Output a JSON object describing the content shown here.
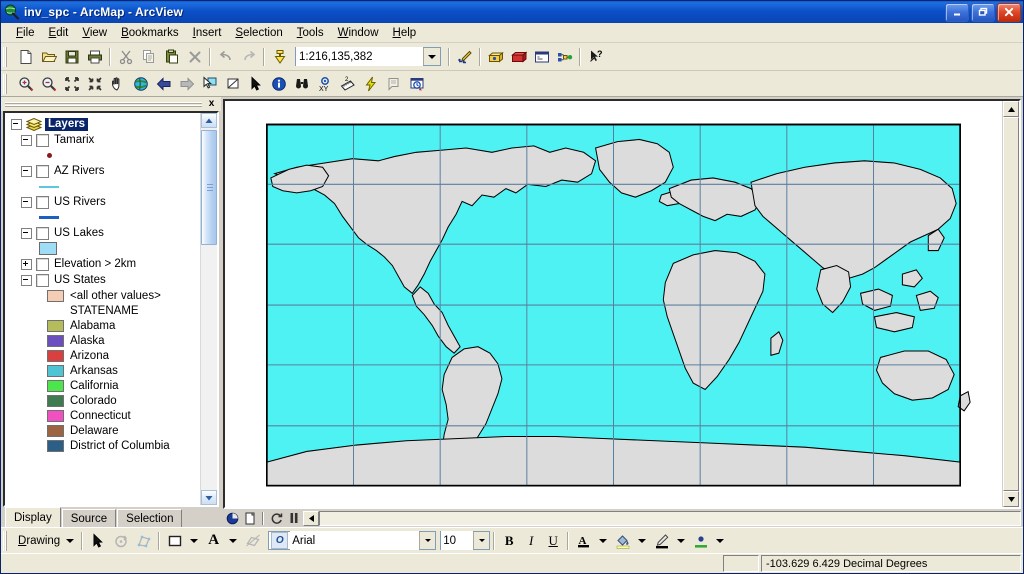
{
  "window": {
    "title": "inv_spc - ArcMap - ArcView",
    "app_icon": "arcmap-globe-icon",
    "minimize_label": "Minimize",
    "restore_label": "Restore",
    "close_label": "Close"
  },
  "menu": {
    "items": [
      {
        "label": "File",
        "accel": "F"
      },
      {
        "label": "Edit",
        "accel": "E"
      },
      {
        "label": "View",
        "accel": "V"
      },
      {
        "label": "Bookmarks",
        "accel": "B"
      },
      {
        "label": "Insert",
        "accel": "I"
      },
      {
        "label": "Selection",
        "accel": "S"
      },
      {
        "label": "Tools",
        "accel": "T"
      },
      {
        "label": "Window",
        "accel": "W"
      },
      {
        "label": "Help",
        "accel": "H"
      }
    ]
  },
  "standard_toolbar": {
    "buttons": [
      {
        "name": "new-document-icon",
        "tip": "New"
      },
      {
        "name": "open-folder-icon",
        "tip": "Open"
      },
      {
        "name": "save-disk-icon",
        "tip": "Save"
      },
      {
        "name": "print-icon",
        "tip": "Print"
      },
      {
        "name": "cut-scissors-icon",
        "tip": "Cut"
      },
      {
        "name": "copy-icon",
        "tip": "Copy"
      },
      {
        "name": "paste-clipboard-icon",
        "tip": "Paste"
      },
      {
        "name": "delete-x-icon",
        "tip": "Delete"
      },
      {
        "name": "undo-arrow-icon",
        "tip": "Undo"
      },
      {
        "name": "redo-arrow-icon",
        "tip": "Redo"
      },
      {
        "name": "add-data-icon",
        "tip": "Add Data"
      }
    ],
    "scale": {
      "value": "1:216,135,382",
      "placeholder": "Map Scale"
    },
    "right_buttons": [
      {
        "name": "editor-toolbar-icon",
        "tip": "Editor Toolbar"
      },
      {
        "name": "arctoolbox-icon",
        "tip": "ArcToolbox"
      },
      {
        "name": "arccatalog-icon",
        "tip": "ArcCatalog"
      },
      {
        "name": "command-line-icon",
        "tip": "Command Line"
      },
      {
        "name": "model-builder-icon",
        "tip": "ModelBuilder"
      },
      {
        "name": "context-help-icon",
        "tip": "What's This?"
      }
    ]
  },
  "tools_toolbar": {
    "buttons": [
      {
        "name": "zoom-in-icon",
        "tip": "Zoom In"
      },
      {
        "name": "zoom-out-icon",
        "tip": "Zoom Out"
      },
      {
        "name": "fixed-zoom-in-icon",
        "tip": "Fixed Zoom In"
      },
      {
        "name": "fixed-zoom-out-icon",
        "tip": "Fixed Zoom Out"
      },
      {
        "name": "pan-hand-icon",
        "tip": "Pan"
      },
      {
        "name": "full-extent-globe-icon",
        "tip": "Full Extent"
      },
      {
        "name": "back-extent-icon",
        "tip": "Go Back To Previous Extent"
      },
      {
        "name": "forward-extent-icon",
        "tip": "Go To Next Extent"
      },
      {
        "name": "select-features-icon",
        "tip": "Select Features"
      },
      {
        "name": "clear-selection-icon",
        "tip": "Clear Selected Features"
      },
      {
        "name": "select-elements-icon",
        "tip": "Select Elements"
      },
      {
        "name": "identify-icon",
        "tip": "Identify"
      },
      {
        "name": "find-binoculars-icon",
        "tip": "Find"
      },
      {
        "name": "go-to-xy-icon",
        "tip": "Go To XY"
      },
      {
        "name": "measure-ruler-icon",
        "tip": "Measure"
      },
      {
        "name": "hyperlink-lightning-icon",
        "tip": "Hyperlink"
      },
      {
        "name": "html-popup-icon",
        "tip": "HTML Popup"
      },
      {
        "name": "time-window-icon",
        "tip": "Time Slider"
      }
    ]
  },
  "toc": {
    "close_label": "x",
    "root": {
      "label": "Layers",
      "selected": true,
      "icon": "layers-stack-icon"
    },
    "layers": [
      {
        "label": "Tamarix",
        "checked": false,
        "expander": "minus",
        "symbol": {
          "kind": "point",
          "color": "#8B1A1A"
        }
      },
      {
        "label": "AZ Rivers",
        "checked": false,
        "expander": "minus",
        "symbol": {
          "kind": "thin-line",
          "color": "#5BC8DC"
        }
      },
      {
        "label": "US Rivers",
        "checked": false,
        "expander": "minus",
        "symbol": {
          "kind": "line",
          "color": "#1F5FBF"
        }
      },
      {
        "label": "US Lakes",
        "checked": false,
        "expander": "minus",
        "symbol": {
          "kind": "polygon",
          "color": "#9FDCF5"
        }
      },
      {
        "label": "Elevation > 2km",
        "checked": false,
        "expander": "plus",
        "symbol": null
      },
      {
        "label": "US States",
        "checked": false,
        "expander": "minus",
        "symbol": null
      }
    ],
    "us_states_legend": {
      "other_values": {
        "label": "<all other values>",
        "color": "#F5CDB4"
      },
      "field_heading": "STATENAME",
      "classes": [
        {
          "label": "Alabama",
          "color": "#B5BC5C"
        },
        {
          "label": "Alaska",
          "color": "#6B4FBF"
        },
        {
          "label": "Arizona",
          "color": "#D94040"
        },
        {
          "label": "Arkansas",
          "color": "#4FC4D4"
        },
        {
          "label": "California",
          "color": "#4CE64C"
        },
        {
          "label": "Colorado",
          "color": "#3F7A50"
        },
        {
          "label": "Connecticut",
          "color": "#F050C0"
        },
        {
          "label": "Delaware",
          "color": "#9C6442"
        },
        {
          "label": "District of Columbia",
          "color": "#2B5F85"
        }
      ]
    },
    "tabs": [
      {
        "label": "Display",
        "active": true
      },
      {
        "label": "Source",
        "active": false
      },
      {
        "label": "Selection",
        "active": false
      }
    ]
  },
  "map_view": {
    "ocean_color": "#4FF2F2",
    "land_color": "#DCDCDC",
    "outline_color": "#000000",
    "graticule_color": "#5B7F9E",
    "background_color": "#FFFFFF",
    "view_buttons": [
      {
        "name": "data-view-icon",
        "tip": "Data View"
      },
      {
        "name": "layout-view-icon",
        "tip": "Layout View"
      },
      {
        "name": "refresh-view-icon",
        "tip": "Refresh View"
      },
      {
        "name": "pause-drawing-icon",
        "tip": "Pause Drawing"
      }
    ]
  },
  "drawing_toolbar": {
    "menu_label": "Drawing",
    "buttons": [
      {
        "name": "select-elements-arrow-icon",
        "tip": "Select Elements"
      },
      {
        "name": "rotate-element-icon",
        "tip": "Rotate"
      },
      {
        "name": "edit-vertices-icon",
        "tip": "Edit Vertices"
      },
      {
        "name": "new-rectangle-icon",
        "tip": "Draw Rectangle"
      },
      {
        "name": "new-text-icon",
        "tip": "New Text"
      },
      {
        "name": "drawing-clip-icon",
        "tip": "Clip Graphic"
      }
    ],
    "font": {
      "name_value": "Arial",
      "name_placeholder": "Font",
      "size_value": "10",
      "size_placeholder": "Size",
      "icon": "font-o-icon"
    },
    "style_buttons": [
      {
        "name": "bold-button",
        "label": "B"
      },
      {
        "name": "italic-button",
        "label": "I"
      },
      {
        "name": "underline-button",
        "label": "U"
      }
    ],
    "color_buttons": [
      {
        "name": "font-color-icon",
        "label": "A",
        "color": "#000000"
      },
      {
        "name": "fill-color-icon",
        "label": "fill",
        "color": "#FFFF99"
      },
      {
        "name": "line-color-icon",
        "label": "line",
        "color": "#000000"
      },
      {
        "name": "marker-color-icon",
        "label": "marker",
        "color": "#33AA33"
      }
    ]
  },
  "status_bar": {
    "coordinates": "-103.629  6.429 Decimal Degrees"
  }
}
